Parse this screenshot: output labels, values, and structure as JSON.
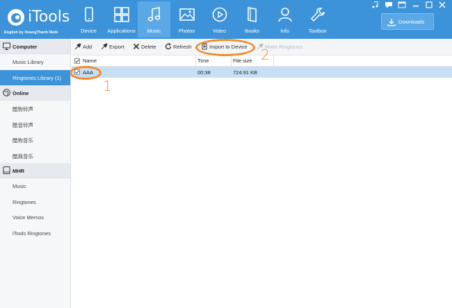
{
  "app": {
    "name": "iTools",
    "subtitle": "English by HoangThanh Mobi"
  },
  "nav": {
    "tabs": [
      {
        "label": "Device",
        "icon": "phone-icon"
      },
      {
        "label": "Applications",
        "icon": "apps-grid-icon"
      },
      {
        "label": "Music",
        "icon": "music-note-icon",
        "active": true
      },
      {
        "label": "Photos",
        "icon": "photo-icon"
      },
      {
        "label": "Video",
        "icon": "play-circle-icon"
      },
      {
        "label": "Books",
        "icon": "book-icon"
      },
      {
        "label": "Info",
        "icon": "person-icon"
      },
      {
        "label": "Toolbox",
        "icon": "wrench-icon"
      }
    ],
    "downloads_label": "Downloads"
  },
  "sidebar": {
    "sections": [
      {
        "title": "Computer",
        "icon": "monitor-icon",
        "items": [
          {
            "label": "Music Library"
          },
          {
            "label": "Ringtones Library (1)",
            "active": true
          }
        ]
      },
      {
        "title": "Online",
        "icon": "globe-icon",
        "items": [
          {
            "label": "酷狗铃声"
          },
          {
            "label": "酷音铃声"
          },
          {
            "label": "酷狗音乐"
          },
          {
            "label": "酷我音乐"
          }
        ]
      },
      {
        "title": "MHR",
        "icon": "device-icon",
        "items": [
          {
            "label": "Music"
          },
          {
            "label": "Ringtones"
          },
          {
            "label": "Voice Memos"
          },
          {
            "label": "iTools Ringtones"
          }
        ]
      }
    ]
  },
  "toolbar": {
    "add": "Add",
    "export": "Export",
    "delete": "Delete",
    "refresh": "Refresh",
    "import_to_device": "Import to Device",
    "make_ringtones": "Make Ringtones"
  },
  "table": {
    "columns": [
      "Name",
      "Time",
      "File size"
    ],
    "rows": [
      {
        "name": "AAA",
        "time": "00:38",
        "size": "724.91 KB",
        "selected": true
      }
    ]
  },
  "annotations": {
    "step1": "1",
    "step2": "2"
  },
  "colors": {
    "accent": "#3d93d9",
    "annotation": "#f28a2a",
    "selection": "#c6dff5"
  }
}
